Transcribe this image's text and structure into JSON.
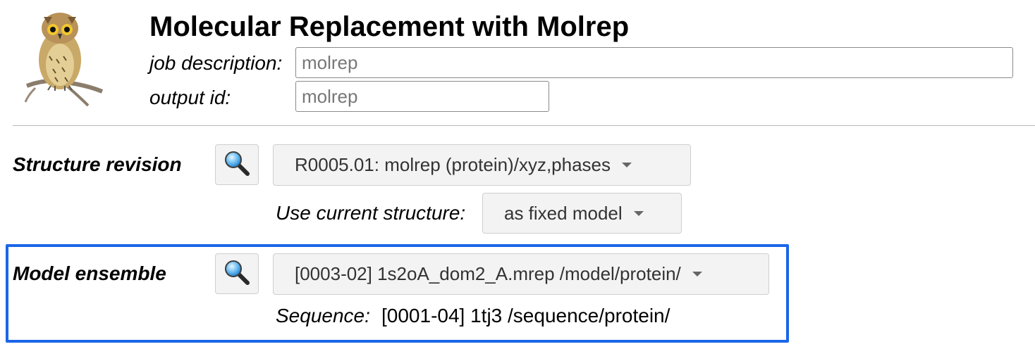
{
  "header": {
    "title": "Molecular Replacement with Molrep",
    "logo_icon": "owl-logo",
    "job_description_label": "job description:",
    "job_description_value": "molrep",
    "output_id_label": "output id:",
    "output_id_value": "molrep"
  },
  "structure_revision": {
    "label": "Structure revision",
    "search_icon": "magnifier-icon",
    "selected": "R0005.01: molrep (protein)/xyz,phases",
    "use_current_label": "Use current structure:",
    "use_current_selected": "as fixed model"
  },
  "model_ensemble": {
    "label": "Model ensemble",
    "search_icon": "magnifier-icon",
    "selected": "[0003-02] 1s2oA_dom2_A.mrep /model/protein/",
    "sequence_label": "Sequence:",
    "sequence_value": "[0001-04] 1tj3 /sequence/protein/"
  },
  "colors": {
    "highlight_border": "#1a66e8",
    "button_bg": "#f3f3f3"
  }
}
